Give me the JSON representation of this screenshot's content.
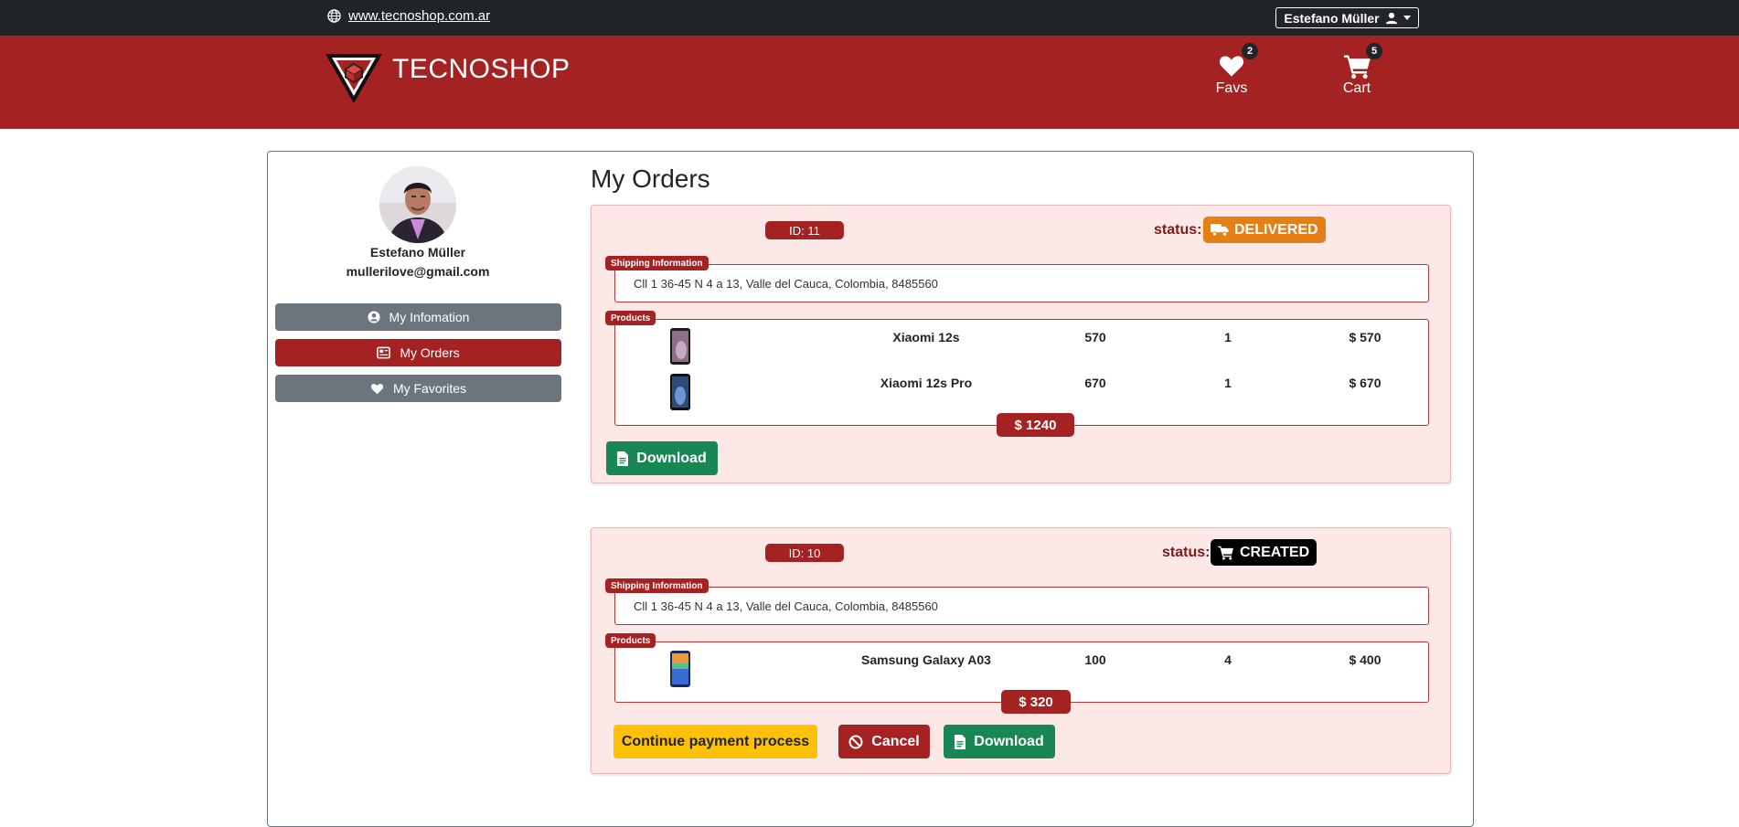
{
  "topbar": {
    "site_link": "www.tecnoshop.com.ar",
    "user_menu": "Estefano Müller"
  },
  "header": {
    "brand": "TECNOSHOP",
    "favs": {
      "label": "Favs",
      "count": "2"
    },
    "cart": {
      "label": "Cart",
      "count": "5"
    }
  },
  "profile": {
    "name": "Estefano Müller",
    "email": "mullerilove@gmail.com"
  },
  "sidebar": {
    "items": [
      {
        "label": "My Infomation",
        "icon": "user-circle-icon"
      },
      {
        "label": "My Orders",
        "icon": "orders-icon"
      },
      {
        "label": "My Favorites",
        "icon": "heart-icon"
      }
    ]
  },
  "main": {
    "title": "My Orders",
    "status_label": "status:",
    "shipping_tag": "Shipping Information",
    "products_tag": "Products",
    "orders": [
      {
        "id": "ID: 11",
        "status": "DELIVERED",
        "status_color": "#e67e16",
        "address": "Cll 1 36-45 N 4 a 13, Valle del Cauca, Colombia, 8485560",
        "products": [
          {
            "name": "Xiaomi 12s",
            "price": "570",
            "qty": "1",
            "total": "$ 570"
          },
          {
            "name": "Xiaomi 12s Pro",
            "price": "670",
            "qty": "1",
            "total": "$ 670"
          }
        ],
        "total": "$ 1240",
        "download_label": "Download"
      },
      {
        "id": "ID: 10",
        "status": "CREATED",
        "status_color": "#000000",
        "address": "Cll 1 36-45 N 4 a 13, Valle del Cauca, Colombia, 8485560",
        "products": [
          {
            "name": "Samsung Galaxy A03",
            "price": "100",
            "qty": "4",
            "total": "$ 400"
          }
        ],
        "total": "$ 320",
        "continue_label": "Continue payment process",
        "cancel_label": "Cancel",
        "download_label": "Download"
      }
    ]
  },
  "colors": {
    "header_red": "#a52222",
    "topbar_dark": "#212529",
    "success_green": "#198754",
    "warning_yellow": "#ffc107",
    "sidebar_grey": "#6c757d"
  }
}
